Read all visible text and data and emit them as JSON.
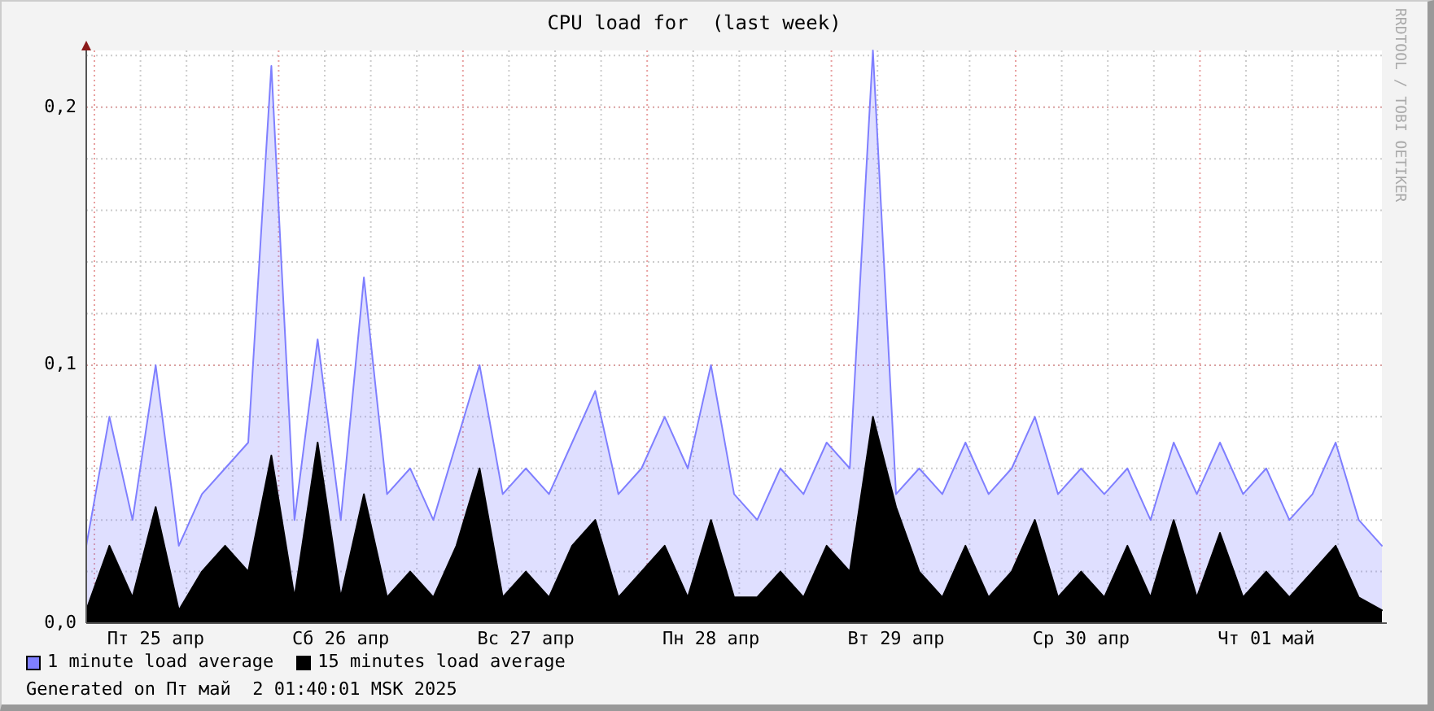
{
  "credit": "RRDTOOL / TOBI OETIKER",
  "chart_data": {
    "type": "area",
    "grid": true,
    "title": "CPU load for  (last week)",
    "ylim": [
      0,
      0.222
    ],
    "categories": [
      null,
      null,
      null,
      "Пт 25 апр",
      null,
      null,
      null,
      null,
      null,
      null,
      null,
      "Сб 26 апр",
      null,
      null,
      null,
      null,
      null,
      null,
      null,
      "Вс 27 апр",
      null,
      null,
      null,
      null,
      null,
      null,
      null,
      "Пн 28 апр",
      null,
      null,
      null,
      null,
      null,
      null,
      null,
      "Вт 29 апр",
      null,
      null,
      null,
      null,
      null,
      null,
      null,
      "Ср 30 апр",
      null,
      null,
      null,
      null,
      null,
      null,
      null,
      "Чт 01 май",
      null,
      null,
      null,
      null,
      null
    ],
    "yticks": [
      {
        "value": 0,
        "label": "0,0"
      },
      {
        "value": 0.1,
        "label": "0,1"
      },
      {
        "value": 0.2,
        "label": "0,2"
      }
    ],
    "series": [
      {
        "name": "1 minute load average",
        "color": "#7f7fff",
        "values": [
          0.03,
          0.08,
          0.04,
          0.1,
          0.03,
          0.05,
          0.06,
          0.07,
          0.216,
          0.04,
          0.11,
          0.04,
          0.134,
          0.05,
          0.06,
          0.04,
          0.07,
          0.1,
          0.05,
          0.06,
          0.05,
          0.07,
          0.09,
          0.05,
          0.06,
          0.08,
          0.06,
          0.1,
          0.05,
          0.04,
          0.06,
          0.05,
          0.07,
          0.06,
          0.222,
          0.05,
          0.06,
          0.05,
          0.07,
          0.05,
          0.06,
          0.08,
          0.05,
          0.06,
          0.05,
          0.06,
          0.04,
          0.07,
          0.05,
          0.07,
          0.05,
          0.06,
          0.04,
          0.05,
          0.07,
          0.04,
          0.03
        ]
      },
      {
        "name": "15 minutes load average",
        "color": "#000000",
        "values": [
          0.005,
          0.03,
          0.01,
          0.045,
          0.005,
          0.02,
          0.03,
          0.02,
          0.065,
          0.01,
          0.07,
          0.01,
          0.05,
          0.01,
          0.02,
          0.01,
          0.03,
          0.06,
          0.01,
          0.02,
          0.01,
          0.03,
          0.04,
          0.01,
          0.02,
          0.03,
          0.01,
          0.04,
          0.01,
          0.01,
          0.02,
          0.01,
          0.03,
          0.02,
          0.08,
          0.045,
          0.02,
          0.01,
          0.03,
          0.01,
          0.02,
          0.04,
          0.01,
          0.02,
          0.01,
          0.03,
          0.01,
          0.04,
          0.01,
          0.035,
          0.01,
          0.02,
          0.01,
          0.02,
          0.03,
          0.01,
          0.005
        ]
      }
    ]
  },
  "footer": "Generated on Пт май  2 01:40:01 MSK 2025"
}
